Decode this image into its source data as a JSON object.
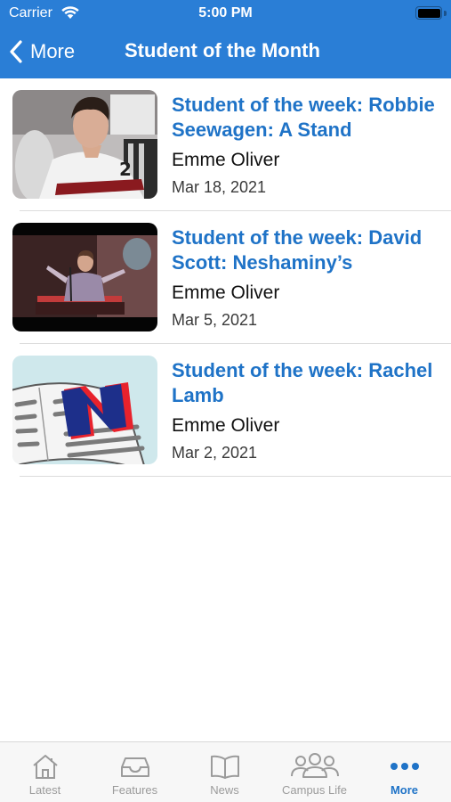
{
  "status_bar": {
    "carrier": "Carrier",
    "time": "5:00 PM"
  },
  "nav": {
    "back_label": "More",
    "title": "Student of the Month"
  },
  "colors": {
    "header_bg": "#2a7ed6",
    "accent": "#1f73c7"
  },
  "articles": [
    {
      "title": "Student of the week: Robbie Seewagen: A Stand",
      "author": "Emme Oliver",
      "date": "Mar 18, 2021"
    },
    {
      "title": "Student of the week: David Scott: Neshaminy’s",
      "author": "Emme Oliver",
      "date": "Mar 5, 2021"
    },
    {
      "title": "Student of the week: Rachel Lamb",
      "author": "Emme Oliver",
      "date": "Mar 2, 2021"
    }
  ],
  "tabbar": {
    "tabs": [
      {
        "label": "Latest",
        "icon": "house-icon"
      },
      {
        "label": "Features",
        "icon": "tray-icon"
      },
      {
        "label": "News",
        "icon": "book-icon"
      },
      {
        "label": "Campus Life",
        "icon": "people-icon"
      },
      {
        "label": "More",
        "icon": "ellipsis-icon"
      }
    ]
  }
}
